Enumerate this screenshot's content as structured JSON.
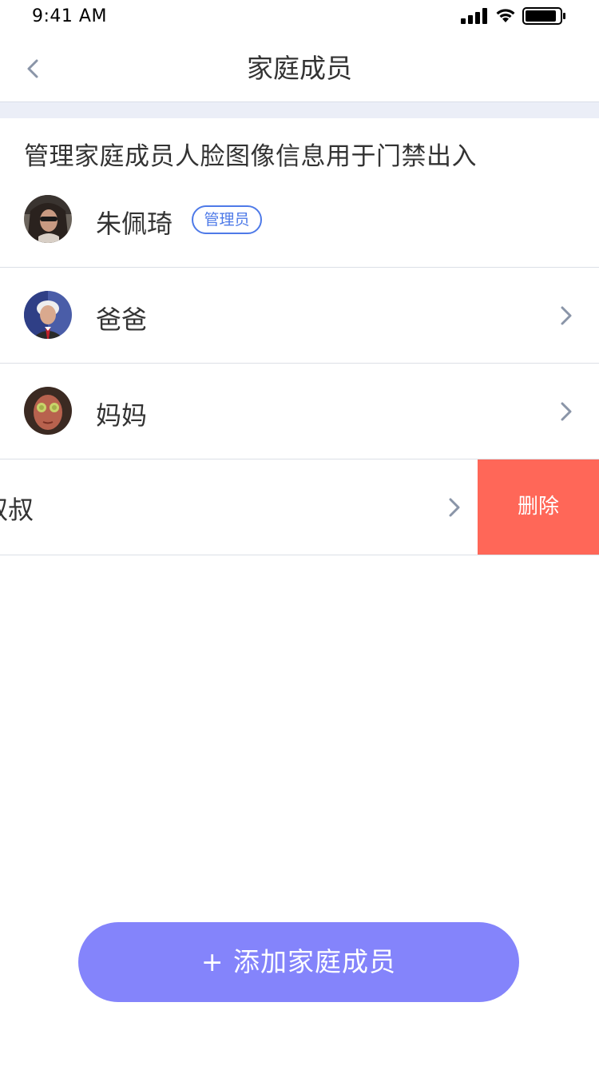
{
  "status_bar": {
    "time": "9:41 AM",
    "icons": [
      "signal-icon",
      "wifi-icon",
      "battery-icon"
    ]
  },
  "nav": {
    "title": "家庭成员",
    "back_icon": "chevron-left-icon"
  },
  "description": "管理家庭成员人脸图像信息用于门禁出入",
  "admin": {
    "name": "朱佩琦",
    "badge": "管理员"
  },
  "members": [
    {
      "name": "爸爸"
    },
    {
      "name": "妈妈"
    },
    {
      "name": "叔叔",
      "visible_text": "叔叔",
      "swiped_open": true
    }
  ],
  "delete_label": "删除",
  "add_button_label": "+ 添加家庭成员",
  "colors": {
    "accent": "#4e7ae8",
    "add_button": "#8484fb",
    "delete": "#ff6758",
    "band": "#ebeef7",
    "chevron": "#8a95a8"
  }
}
